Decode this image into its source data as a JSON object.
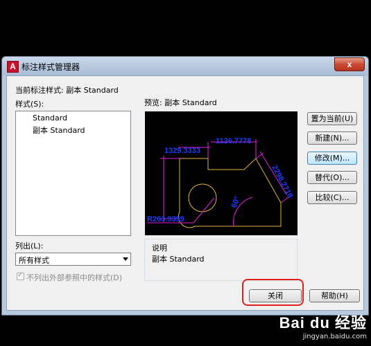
{
  "window": {
    "title": "标注样式管理器",
    "app_icon_label": "A",
    "close_glyph": "x"
  },
  "current_style": {
    "label": "当前标注样式:",
    "value": "副本 Standard"
  },
  "styles_list": {
    "label": "样式(S):",
    "items": [
      {
        "label": "Standard"
      },
      {
        "label": "副本 Standard"
      }
    ]
  },
  "preview": {
    "label": "预览:",
    "style_name": "副本 Standard",
    "dims": {
      "top_width": "1126.7778",
      "left_width": "1329.3333",
      "diag_length": "2298.2718",
      "angle": "60°",
      "radius": "R263.9359"
    },
    "colors": {
      "geometry": "#e2b63a",
      "dimension": "#e020e0",
      "text": "#1c3cff"
    }
  },
  "buttons": {
    "set_current": "置为当前(U)",
    "new": "新建(N)...",
    "modify": "修改(M)...",
    "override": "替代(O)...",
    "compare": "比较(C)...",
    "close": "关闭",
    "help": "帮助(H)"
  },
  "list_filter": {
    "label": "列出(L):",
    "selected": "所有样式"
  },
  "exclude_xref": {
    "label": "不列出外部参照中的样式(D)",
    "checked": true
  },
  "description": {
    "label": "说明",
    "text": "副本 Standard"
  },
  "watermark": {
    "logo": "Bai du 经验",
    "url": "jingyan.baidu.com"
  },
  "accent_highlight": "#e01e1e"
}
